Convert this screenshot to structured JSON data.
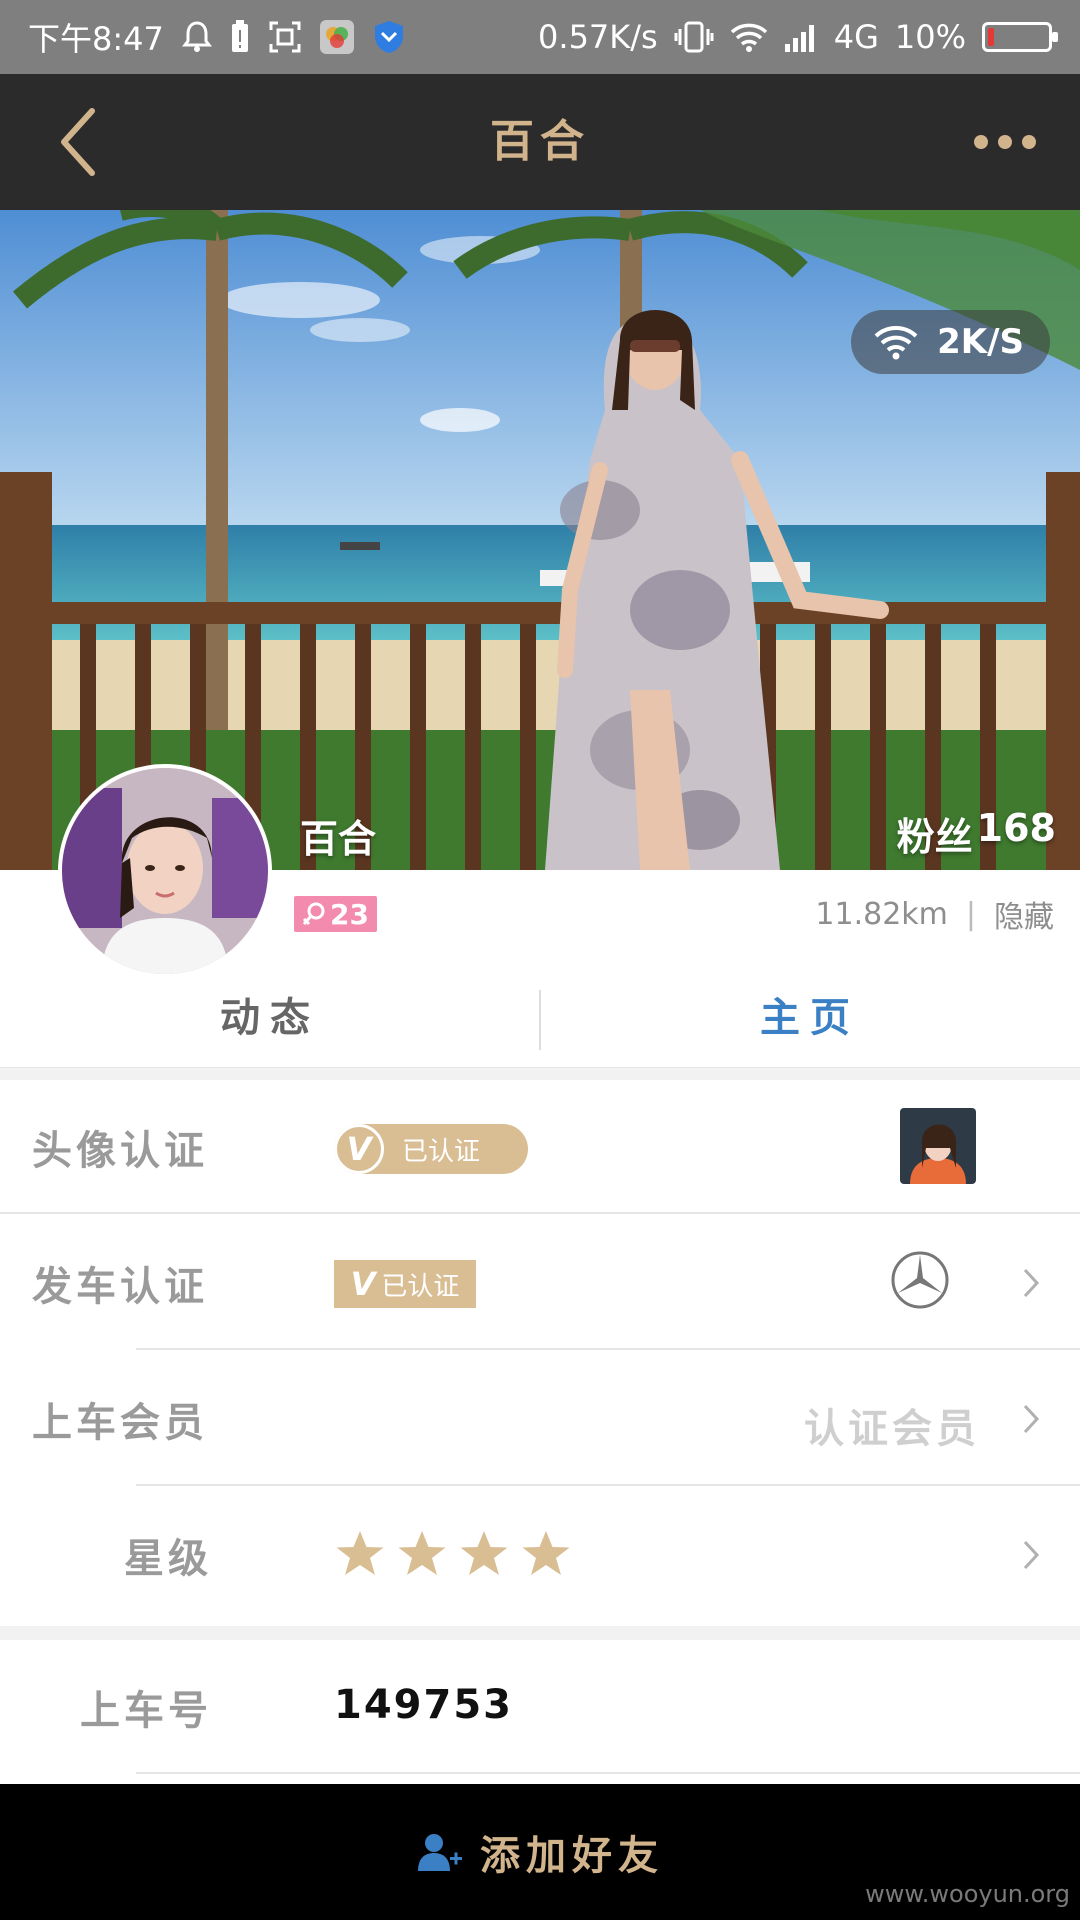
{
  "status_bar": {
    "time": "下午8:47",
    "net_speed": "0.57K/s",
    "network": "4G",
    "battery_percent": "10%",
    "battery_level": 0.1
  },
  "header": {
    "title": "百合"
  },
  "cover": {
    "speed_badge": "2K/S",
    "name": "百合",
    "fans_label": "粉丝",
    "fans_count": "168"
  },
  "profile": {
    "gender_age": "23",
    "distance": "11.82km",
    "separator": "|",
    "visibility": "隐藏"
  },
  "tabs": [
    {
      "label": "动态",
      "active": false
    },
    {
      "label": "主页",
      "active": true
    }
  ],
  "rows": {
    "avatar_cert": {
      "label": "头像认证",
      "badge_v": "V",
      "badge_text": "已认证"
    },
    "car_cert": {
      "label": "发车认证",
      "badge_v": "V",
      "badge_text": "已认证"
    },
    "member": {
      "label": "上车会员",
      "value": "认证会员"
    },
    "level": {
      "label": "星级",
      "stars": 4
    },
    "number": {
      "label": "上车号",
      "value": "149753"
    }
  },
  "bottom_bar": {
    "add_friend": "添加好友"
  },
  "watermark": "www.wooyun.org",
  "colors": {
    "accent_gold": "#d2b48c",
    "active_tab": "#3b7fc4",
    "header_bg": "#2b2b2b",
    "badge_bg": "#d9be94",
    "gender_tag": "#f28bae"
  }
}
